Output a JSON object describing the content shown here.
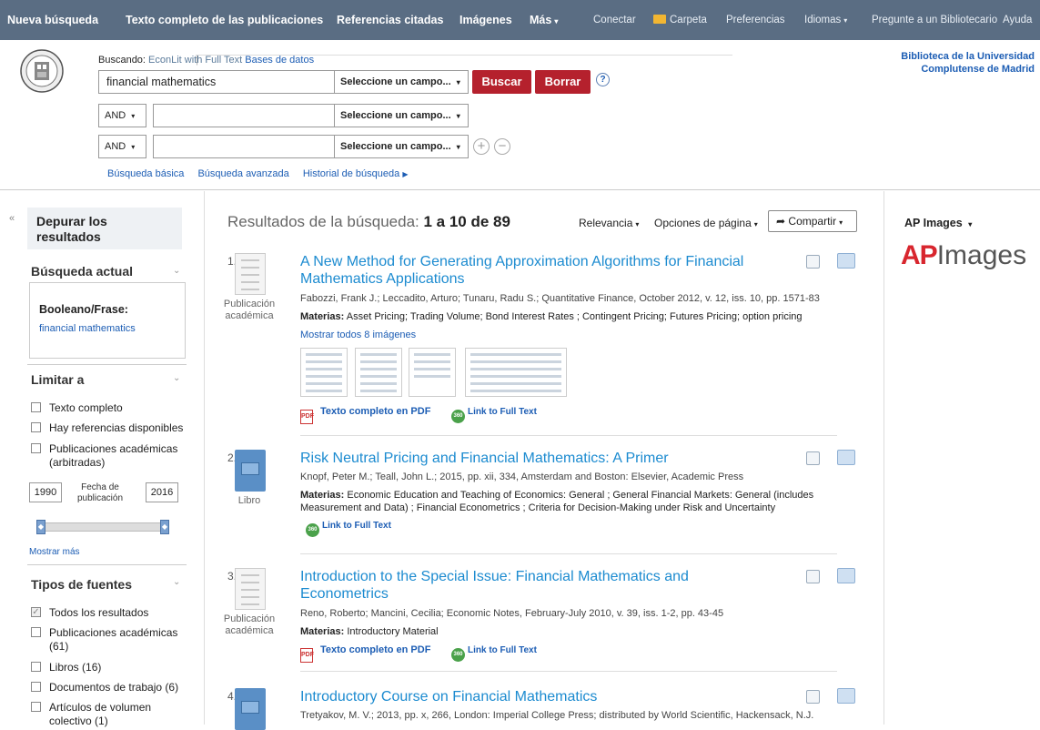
{
  "topnav": {
    "left": [
      "Nueva búsqueda",
      "Texto completo de las publicaciones",
      "Referencias citadas",
      "Imágenes",
      "Más"
    ],
    "right": [
      "Conectar",
      "Carpeta",
      "Preferencias",
      "Idiomas",
      "Pregunte a un Bibliotecario",
      "Ayuda"
    ]
  },
  "search": {
    "searching_label": "Buscando:",
    "database": "EconLit with Full Text",
    "databases_link": "Bases de datos",
    "query1": "financial mathematics",
    "field_placeholder": "Seleccione un campo...",
    "bool": "AND",
    "search_button": "Buscar",
    "clear_button": "Borrar",
    "help": "?",
    "links": [
      "Búsqueda básica",
      "Búsqueda avanzada",
      "Historial de búsqueda"
    ]
  },
  "institution": {
    "line1": "Biblioteca de la Universidad",
    "line2": "Complutense de Madrid"
  },
  "sidebar": {
    "title": "Depurar los resultados",
    "current_search": "Búsqueda actual",
    "bool_label": "Booleano/Frase:",
    "bool_value": "financial mathematics",
    "limit_to": "Limitar a",
    "limits": [
      "Texto completo",
      "Hay referencias disponibles",
      "Publicaciones académicas (arbitradas)"
    ],
    "year_from": "1990",
    "year_to": "2016",
    "date_label": "Fecha de publicación",
    "show_more": "Mostrar más",
    "source_types": "Tipos de fuentes",
    "sources": [
      "Todos los resultados",
      "Publicaciones académicas (61)",
      "Libros (16)",
      "Documentos de trabajo (6)",
      "Artículos de volumen colectivo (1)"
    ]
  },
  "results": {
    "label": "Resultados de la búsqueda:",
    "range": "1 a 10 de 89",
    "relevance": "Relevancia",
    "page_options": "Opciones de página",
    "share": "Compartir",
    "items": [
      {
        "num": "1.",
        "type": "Publicación académica",
        "title": "A New Method for Generating Approximation Algorithms for Financial Mathematics Applications",
        "meta": "Fabozzi, Frank J.; Leccadito, Arturo; Tunaru, Radu S.; Quantitative Finance, October 2012, v. 12, iss. 10, pp. 1571-83",
        "subjects_label": "Materias:",
        "subjects": "Asset Pricing; Trading Volume; Bond Interest Rates ; Contingent Pricing; Futures Pricing; option pricing",
        "show_images": "Mostrar todos 8 imágenes",
        "pdf": "Texto completo en PDF",
        "link360": "Link to Full Text"
      },
      {
        "num": "2.",
        "type": "Libro",
        "title": "Risk Neutral Pricing and Financial Mathematics: A Primer",
        "meta": "Knopf, Peter M.; Teall, John L.; 2015, pp. xii, 334, Amsterdam and Boston: Elsevier, Academic Press",
        "subjects_label": "Materias:",
        "subjects": "Economic Education and Teaching of Economics: General ; General Financial Markets: General (includes Measurement and Data) ; Financial Econometrics ; Criteria for Decision-Making under Risk and Uncertainty",
        "link360": "Link to Full Text"
      },
      {
        "num": "3.",
        "type": "Publicación académica",
        "title": "Introduction to the Special Issue: Financial Mathematics and Econometrics",
        "meta": "Reno, Roberto; Mancini, Cecilia; Economic Notes, February-July 2010, v. 39, iss. 1-2, pp. 43-45",
        "subjects_label": "Materias:",
        "subjects": "Introductory Material",
        "pdf": "Texto completo en PDF",
        "link360": "Link to Full Text"
      },
      {
        "num": "4.",
        "title": "Introductory Course on Financial Mathematics",
        "meta": "Tretyakov, M. V.; 2013, pp. x, 266, London: Imperial College Press; distributed by World Scientific, Hackensack, N.J."
      }
    ]
  },
  "rightpanel": {
    "title": "AP Images",
    "logo_ap": "AP",
    "logo_images": "Images"
  },
  "icons": {
    "pdf": "pdf-icon",
    "badge360": "360-badge-icon",
    "badge_text": "360",
    "collapse": "«",
    "caret": "▾"
  }
}
